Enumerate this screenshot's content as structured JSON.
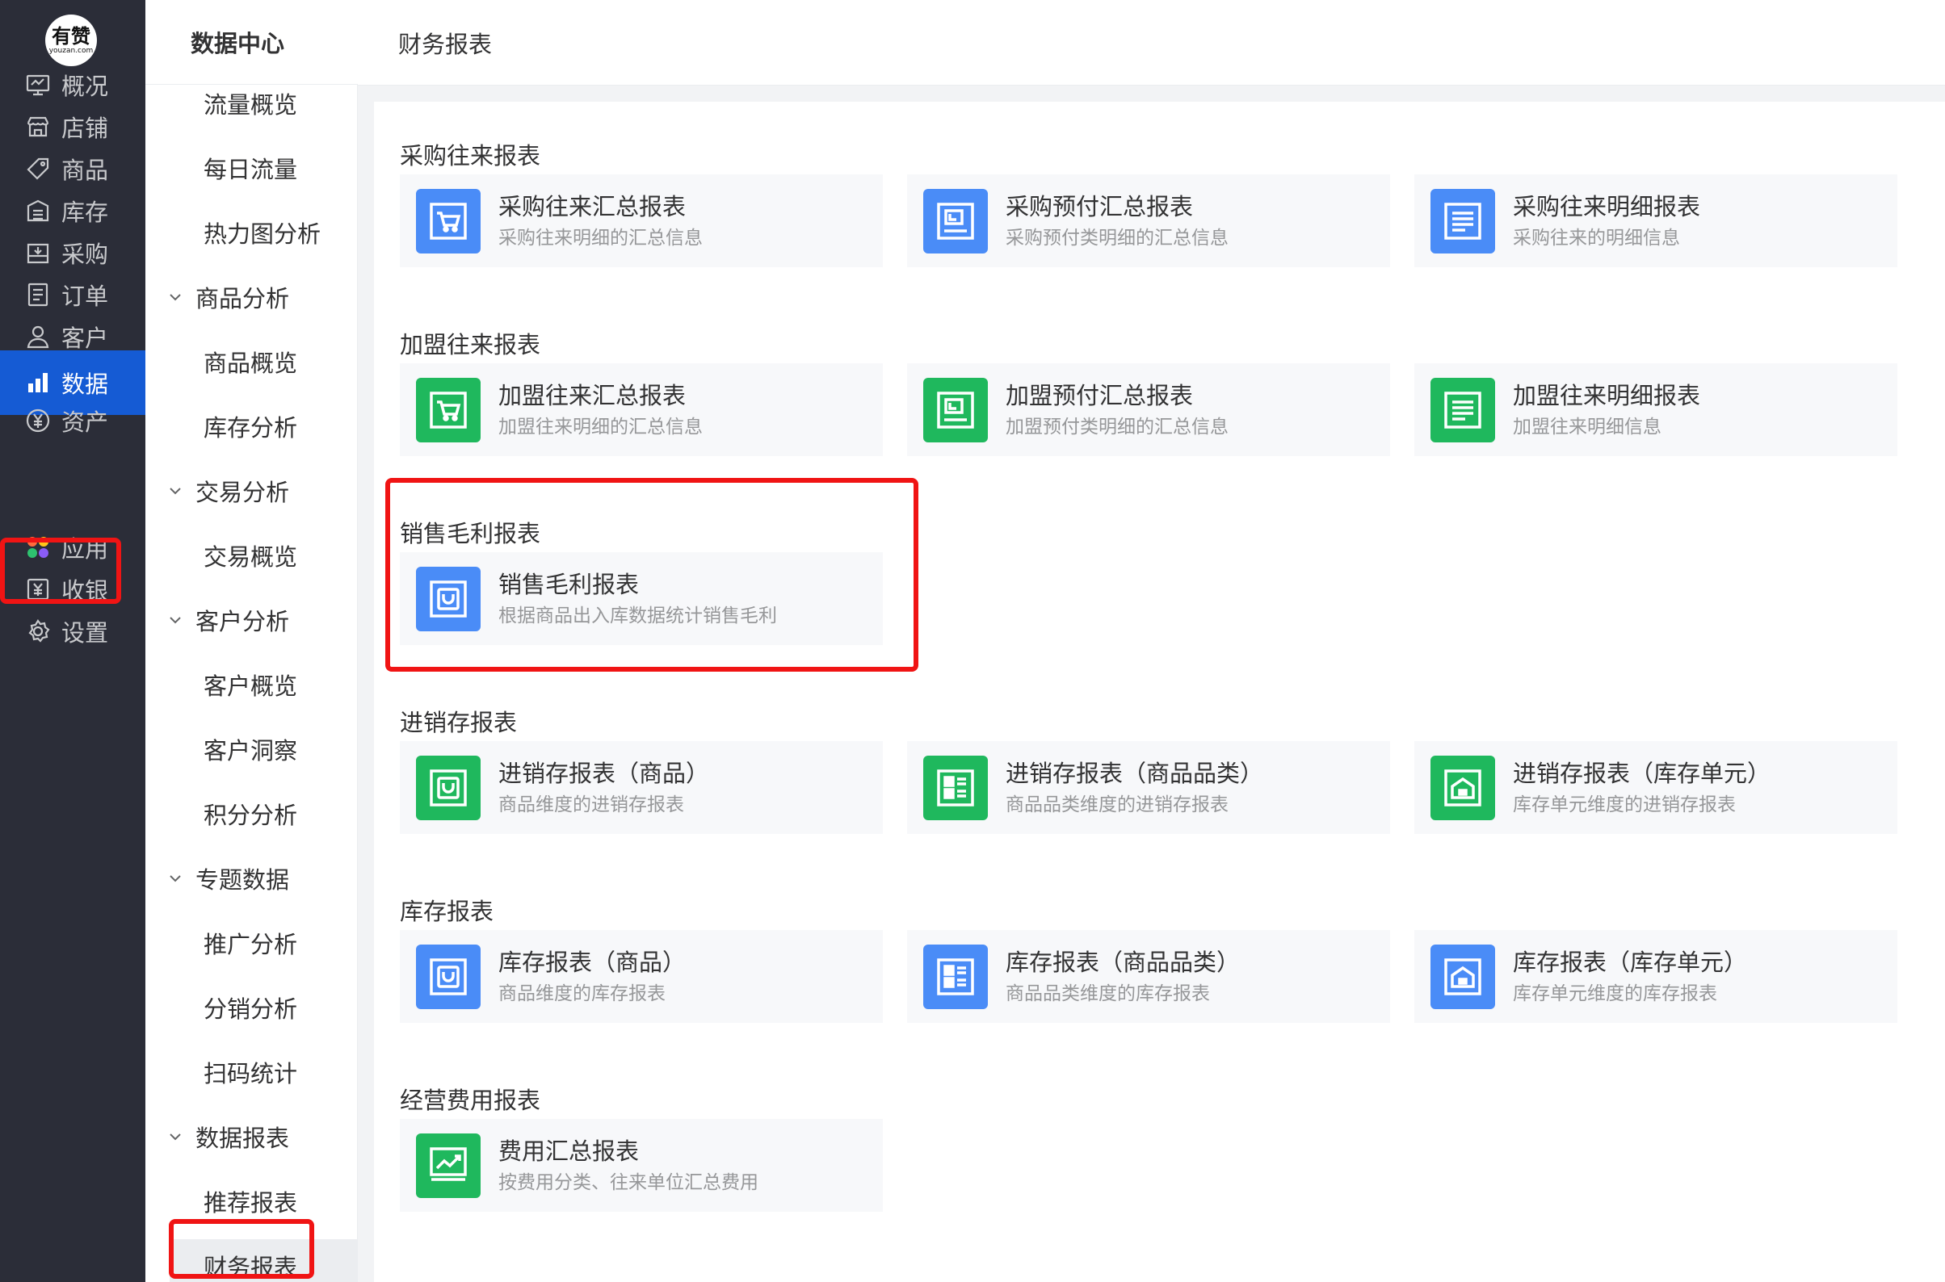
{
  "logo": {
    "main": "有赞",
    "sub": "youzan.com"
  },
  "primary_nav": [
    {
      "id": "overview",
      "label": "概况",
      "icon": "monitor-icon"
    },
    {
      "id": "shop",
      "label": "店铺",
      "icon": "store-icon"
    },
    {
      "id": "goods",
      "label": "商品",
      "icon": "tag-icon"
    },
    {
      "id": "inventory",
      "label": "库存",
      "icon": "warehouse-icon"
    },
    {
      "id": "purchase",
      "label": "采购",
      "icon": "purchase-icon"
    },
    {
      "id": "orders",
      "label": "订单",
      "icon": "order-icon"
    },
    {
      "id": "customers",
      "label": "客户",
      "icon": "user-icon"
    },
    {
      "id": "data",
      "label": "数据",
      "icon": "bar-chart-icon",
      "active": true
    },
    {
      "id": "assets",
      "label": "资产",
      "icon": "yen-icon"
    },
    {
      "id": "apps",
      "label": "应用",
      "icon": "apps-icon"
    },
    {
      "id": "cashier",
      "label": "收银",
      "icon": "cashier-icon"
    },
    {
      "id": "settings",
      "label": "设置",
      "icon": "gear-icon"
    }
  ],
  "secondary_nav": {
    "title": "数据中心",
    "items": [
      {
        "label": "流量概览",
        "type": "leaf"
      },
      {
        "label": "每日流量",
        "type": "leaf"
      },
      {
        "label": "热力图分析",
        "type": "leaf"
      },
      {
        "label": "商品分析",
        "type": "group"
      },
      {
        "label": "商品概览",
        "type": "leaf"
      },
      {
        "label": "库存分析",
        "type": "leaf"
      },
      {
        "label": "交易分析",
        "type": "group"
      },
      {
        "label": "交易概览",
        "type": "leaf"
      },
      {
        "label": "客户分析",
        "type": "group"
      },
      {
        "label": "客户概览",
        "type": "leaf"
      },
      {
        "label": "客户洞察",
        "type": "leaf"
      },
      {
        "label": "积分分析",
        "type": "leaf"
      },
      {
        "label": "专题数据",
        "type": "group"
      },
      {
        "label": "推广分析",
        "type": "leaf"
      },
      {
        "label": "分销分析",
        "type": "leaf"
      },
      {
        "label": "扫码统计",
        "type": "leaf"
      },
      {
        "label": "数据报表",
        "type": "group"
      },
      {
        "label": "推荐报表",
        "type": "leaf"
      },
      {
        "label": "财务报表",
        "type": "leaf",
        "active": true
      }
    ]
  },
  "header": {
    "title": "财务报表"
  },
  "sections": [
    {
      "title": "采购往来报表",
      "cards": [
        {
          "name": "采购往来汇总报表",
          "desc": "采购往来明细的汇总信息",
          "color": "blue",
          "icon": "cart-icon"
        },
        {
          "name": "采购预付汇总报表",
          "desc": "采购预付类明细的汇总信息",
          "color": "blue",
          "icon": "prepay-icon"
        },
        {
          "name": "采购往来明细报表",
          "desc": "采购往来的明细信息",
          "color": "blue",
          "icon": "list-icon"
        }
      ]
    },
    {
      "title": "加盟往来报表",
      "cards": [
        {
          "name": "加盟往来汇总报表",
          "desc": "加盟往来明细的汇总信息",
          "color": "green",
          "icon": "cart-icon"
        },
        {
          "name": "加盟预付汇总报表",
          "desc": "加盟预付类明细的汇总信息",
          "color": "green",
          "icon": "prepay-icon"
        },
        {
          "name": "加盟往来明细报表",
          "desc": "加盟往来明细信息",
          "color": "green",
          "icon": "list-icon"
        }
      ]
    },
    {
      "title": "销售毛利报表",
      "cards": [
        {
          "name": "销售毛利报表",
          "desc": "根据商品出入库数据统计销售毛利",
          "color": "blue",
          "icon": "bag-icon"
        }
      ]
    },
    {
      "title": "进销存报表",
      "cards": [
        {
          "name": "进销存报表（商品）",
          "desc": "商品维度的进销存报表",
          "color": "green",
          "icon": "bag-icon"
        },
        {
          "name": "进销存报表（商品品类）",
          "desc": "商品品类维度的进销存报表",
          "color": "green",
          "icon": "category-icon"
        },
        {
          "name": "进销存报表（库存单元）",
          "desc": "库存单元维度的进销存报表",
          "color": "green",
          "icon": "warehouse-unit-icon"
        }
      ]
    },
    {
      "title": "库存报表",
      "cards": [
        {
          "name": "库存报表（商品）",
          "desc": "商品维度的库存报表",
          "color": "blue",
          "icon": "bag-icon"
        },
        {
          "name": "库存报表（商品品类）",
          "desc": "商品品类维度的库存报表",
          "color": "blue",
          "icon": "category-icon"
        },
        {
          "name": "库存报表（库存单元）",
          "desc": "库存单元维度的库存报表",
          "color": "blue",
          "icon": "warehouse-unit-icon"
        }
      ]
    },
    {
      "title": "经营费用报表",
      "cards": [
        {
          "name": "费用汇总报表",
          "desc": "按费用分类、往来单位汇总费用",
          "color": "green",
          "icon": "trend-icon"
        }
      ]
    }
  ],
  "colors": {
    "sidebar_bg": "#2b2d38",
    "active_blue": "#155bd4",
    "highlight_red": "#f01414",
    "card_blue": "#4a8cf7",
    "card_green": "#1fb85d"
  }
}
